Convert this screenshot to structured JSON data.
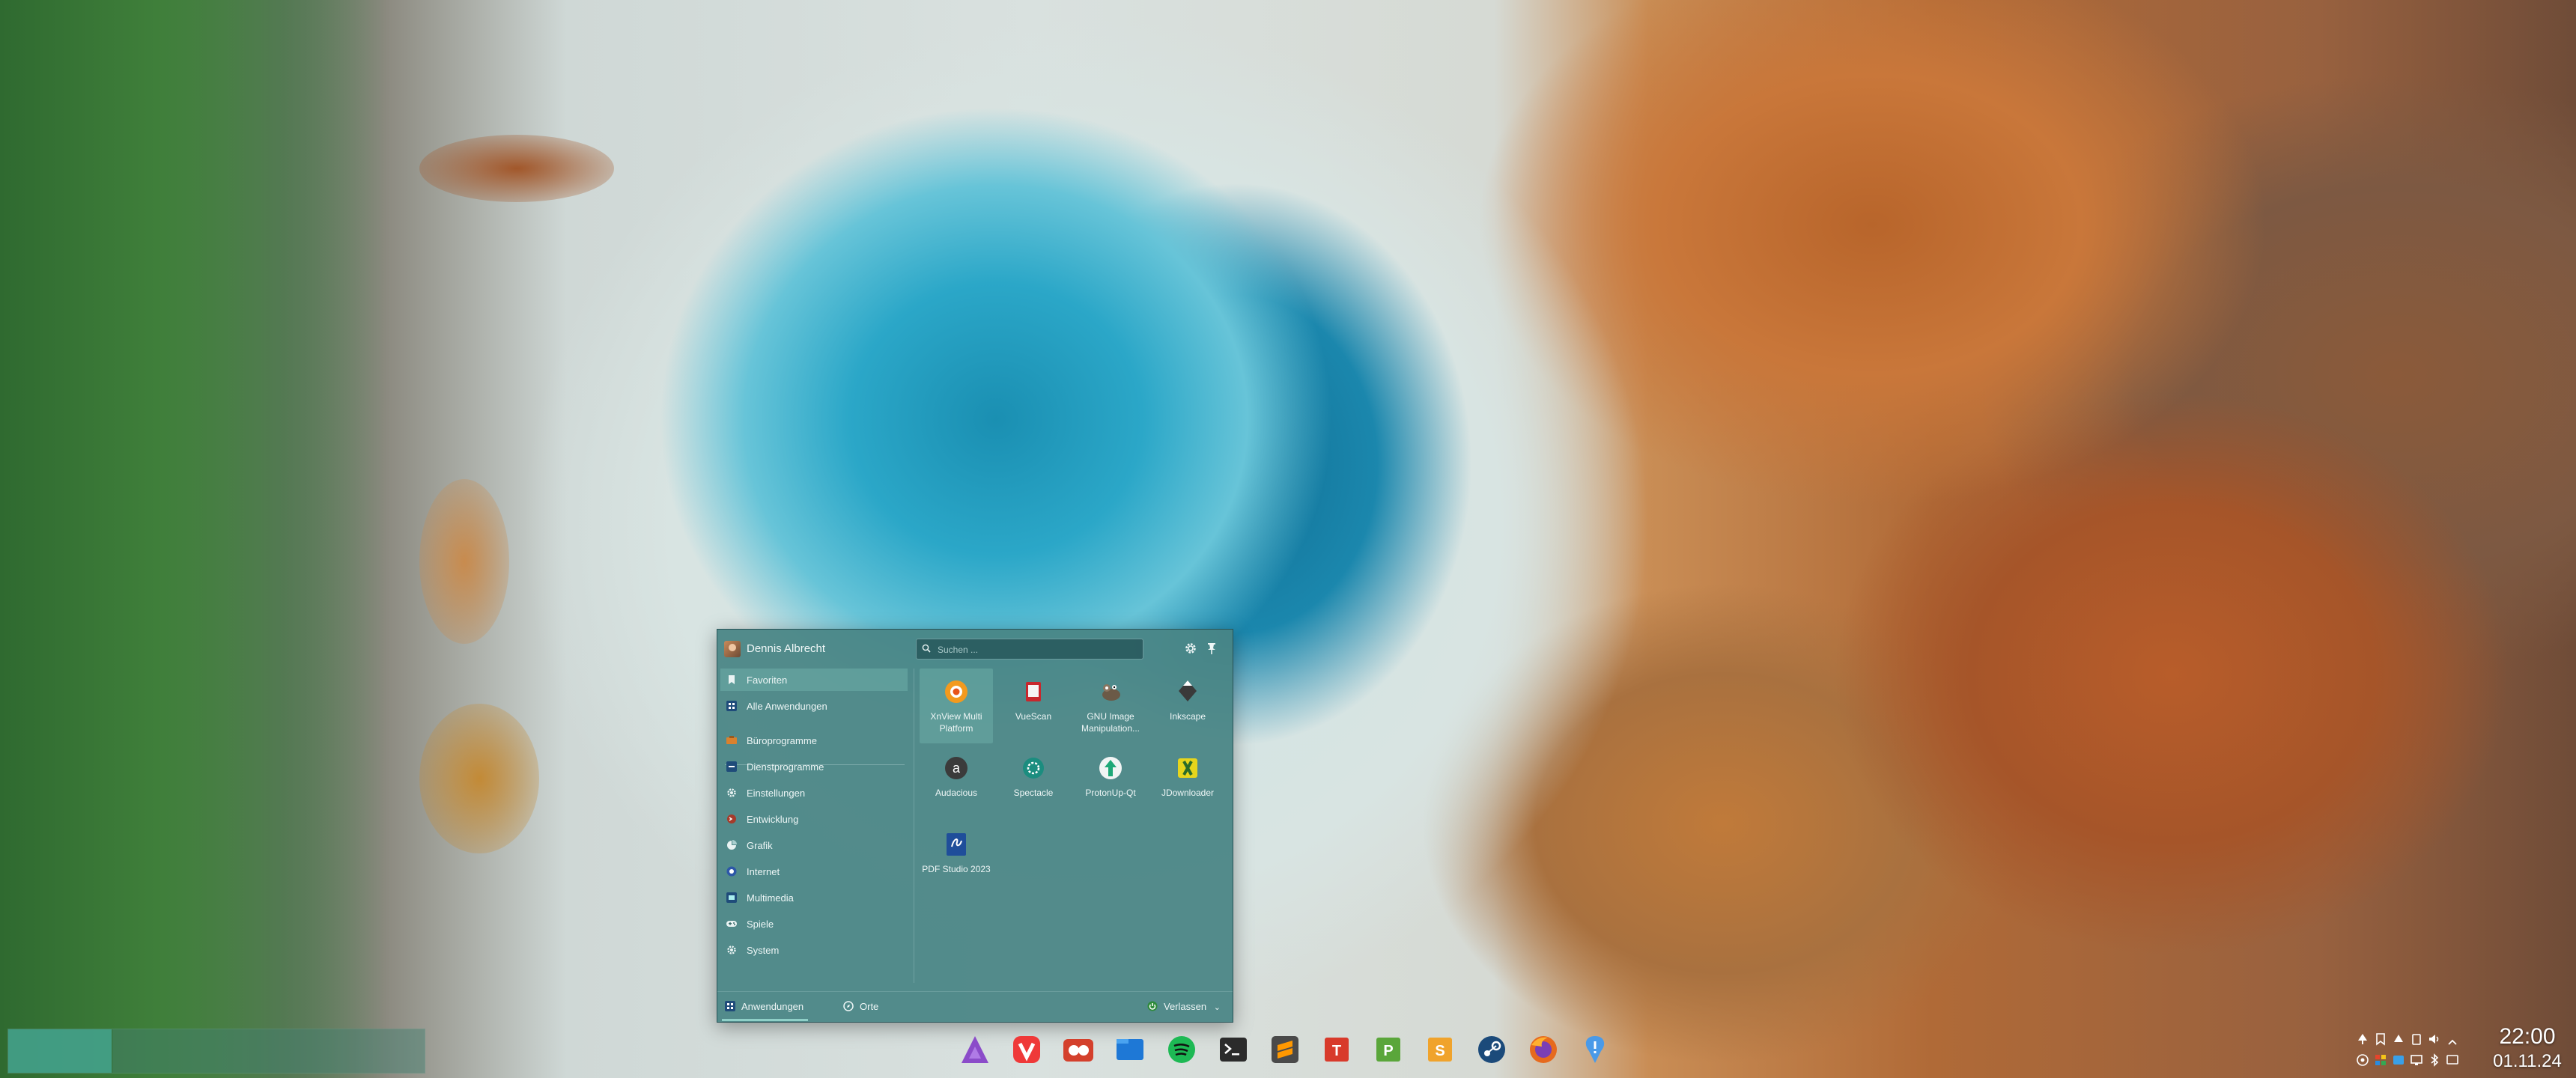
{
  "user": {
    "name": "Dennis Albrecht"
  },
  "search": {
    "placeholder": "Suchen ..."
  },
  "sidebar": {
    "items": [
      {
        "label": "Favoriten",
        "icon": "bookmark-icon",
        "active": true
      },
      {
        "label": "Alle Anwendungen",
        "icon": "all-apps-icon"
      },
      {
        "label": "Büroprogramme",
        "icon": "office-icon"
      },
      {
        "label": "Dienstprogramme",
        "icon": "utilities-icon"
      },
      {
        "label": "Einstellungen",
        "icon": "settings-icon"
      },
      {
        "label": "Entwicklung",
        "icon": "development-icon"
      },
      {
        "label": "Grafik",
        "icon": "graphics-icon"
      },
      {
        "label": "Internet",
        "icon": "internet-icon"
      },
      {
        "label": "Multimedia",
        "icon": "multimedia-icon"
      },
      {
        "label": "Spiele",
        "icon": "games-icon"
      },
      {
        "label": "System",
        "icon": "system-icon"
      }
    ]
  },
  "favorites": [
    {
      "name": "XnView Multi Platform",
      "icon": "xnview-icon"
    },
    {
      "name": "VueScan",
      "icon": "vuescan-icon"
    },
    {
      "name": "GNU Image Manipulation...",
      "icon": "gimp-icon"
    },
    {
      "name": "Inkscape",
      "icon": "inkscape-icon"
    },
    {
      "name": "Audacious",
      "icon": "audacious-icon"
    },
    {
      "name": "Spectacle",
      "icon": "spectacle-icon"
    },
    {
      "name": "ProtonUp-Qt",
      "icon": "protonup-icon"
    },
    {
      "name": "JDownloader",
      "icon": "jdownloader-icon"
    },
    {
      "name": "PDF Studio 2023",
      "icon": "pdf-studio-icon"
    }
  ],
  "footer": {
    "applications": "Anwendungen",
    "places": "Orte",
    "leave": "Verlassen"
  },
  "taskbar": {
    "apps": [
      "arch-icon",
      "vivaldi-icon",
      "dolphin-alt-icon",
      "files-icon",
      "spotify-icon",
      "terminal-icon",
      "sublime-icon",
      "softmaker-textmaker-icon",
      "softmaker-planmaker-icon",
      "softmaker-presentations-icon",
      "steam-icon",
      "firefox-icon",
      "feedback-icon"
    ],
    "clock_time": "22:00",
    "clock_date": "01.11.24"
  },
  "colors": {
    "accent": "#8fd0c8",
    "panel": "#4a8484"
  }
}
